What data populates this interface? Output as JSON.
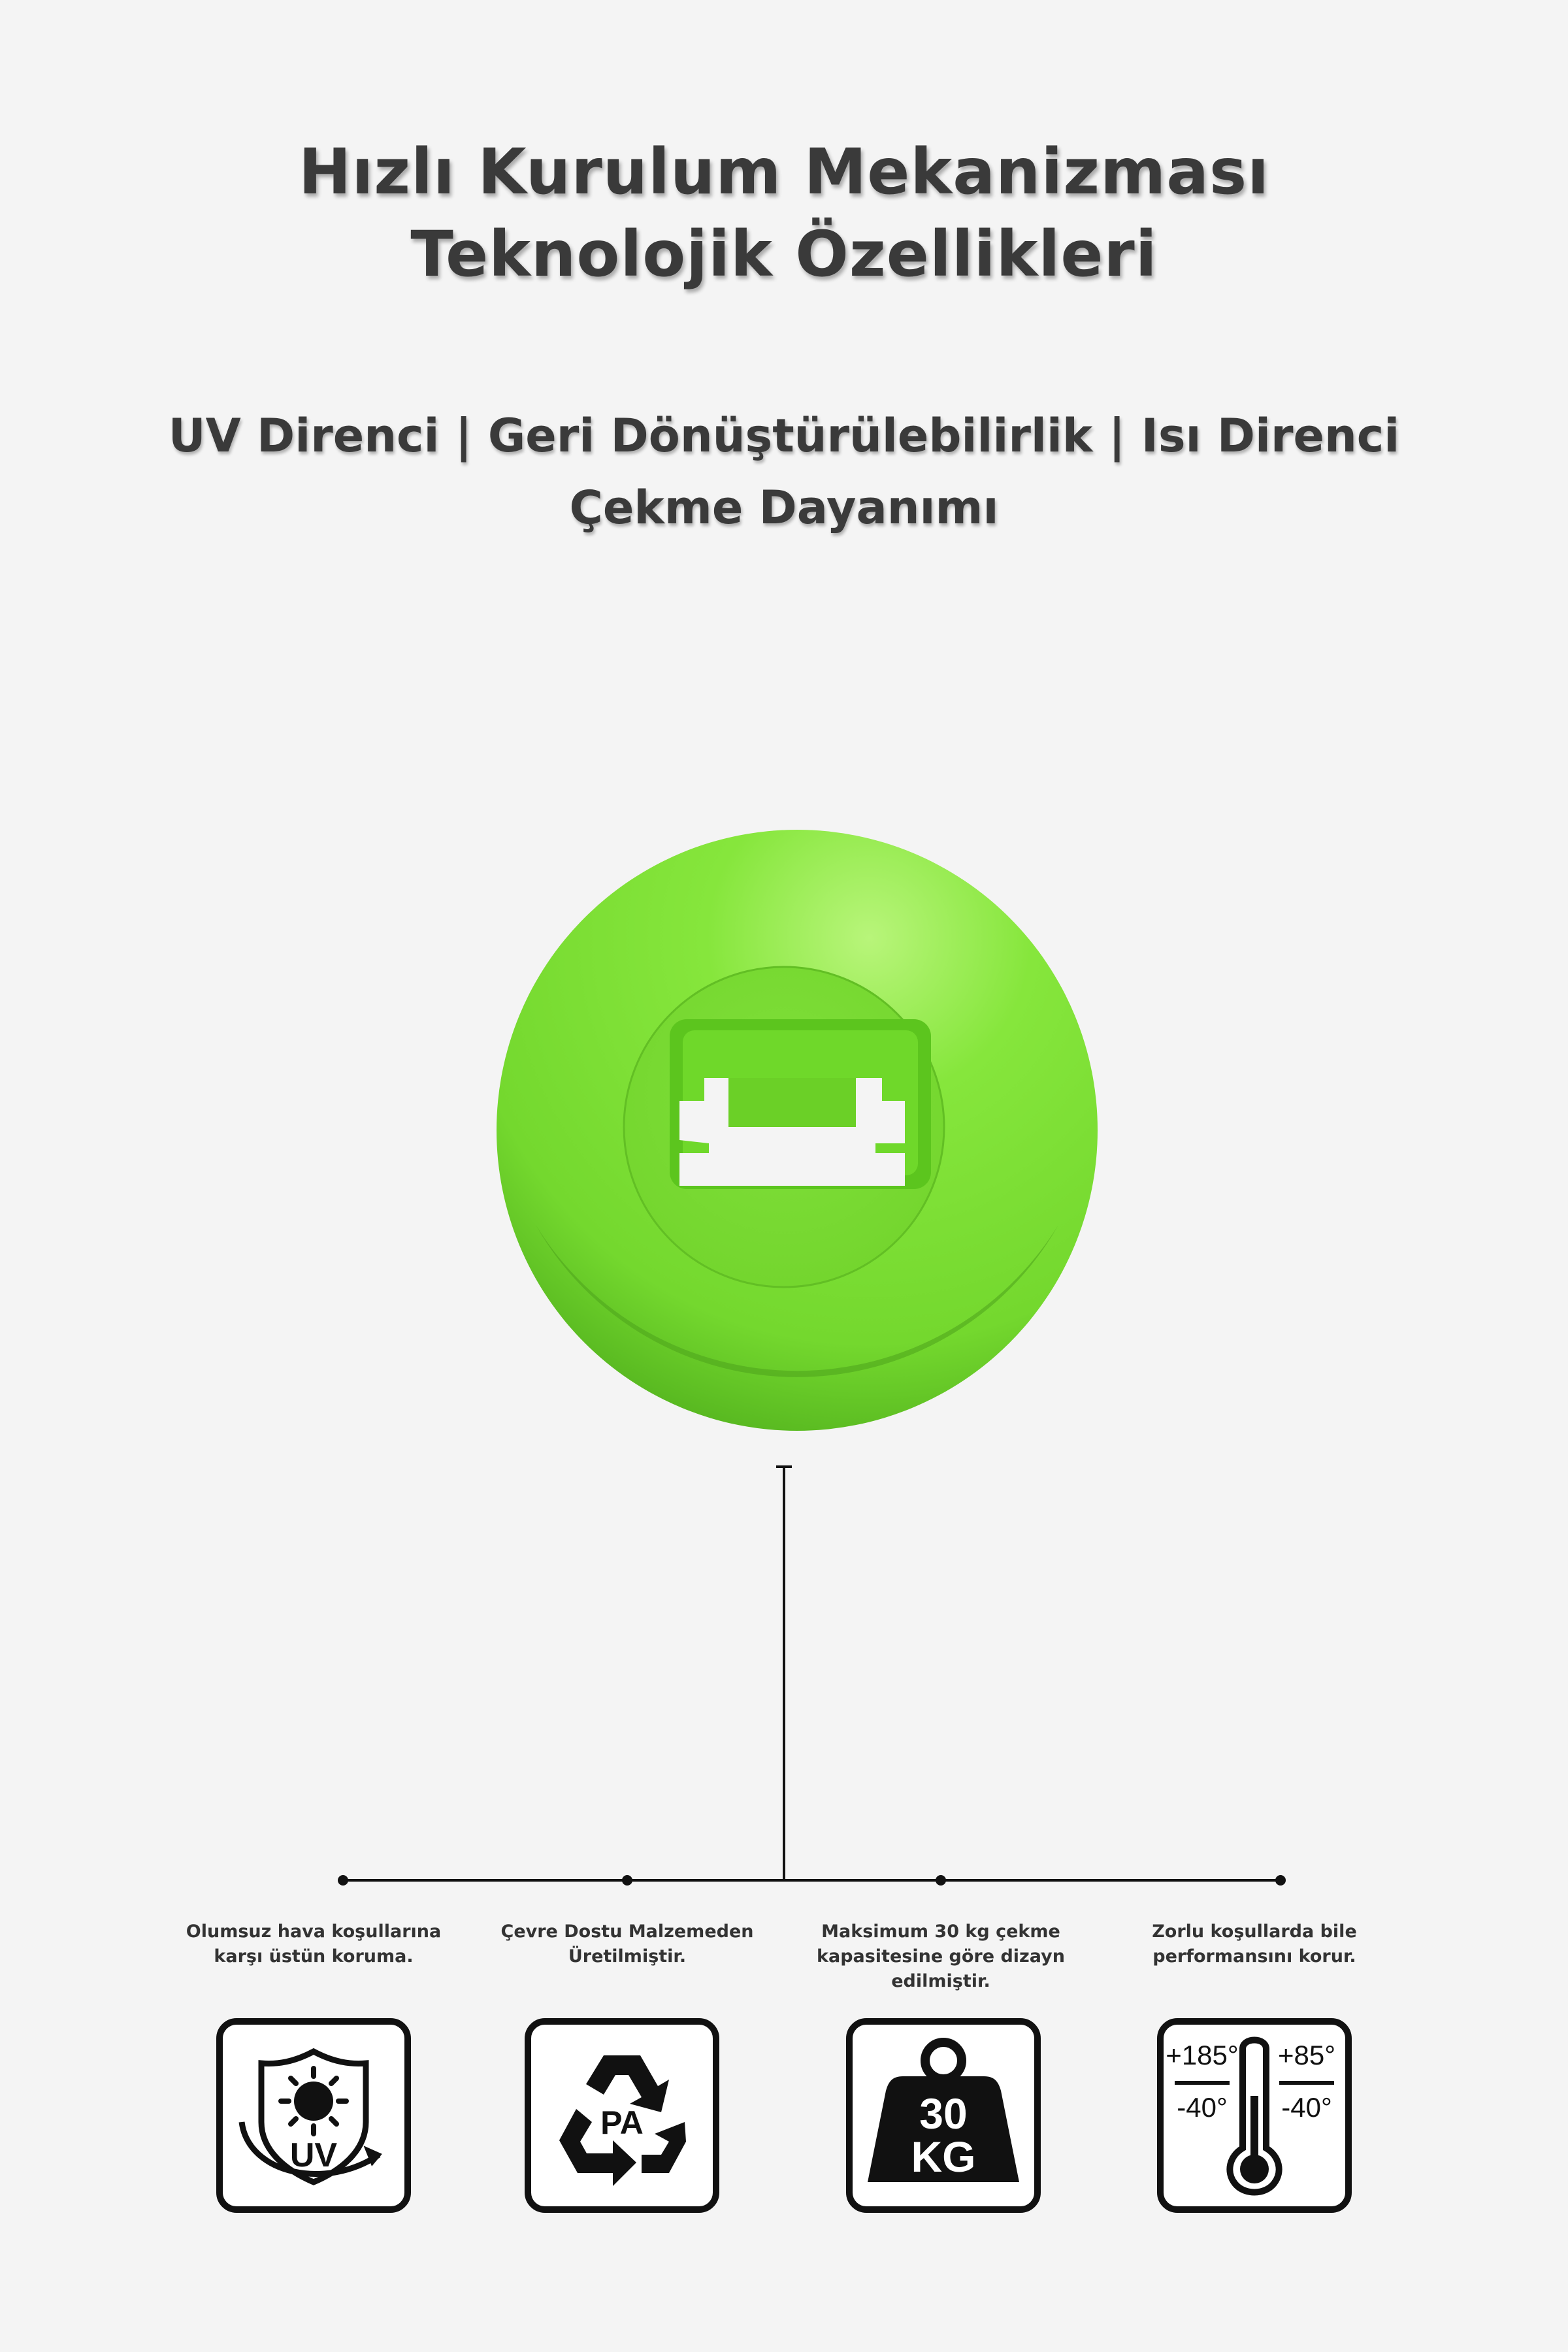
{
  "title": {
    "line1": "Hızlı Kurulum Mekanizması",
    "line2": "Teknolojik Özellikleri"
  },
  "subtitle": {
    "line1": "UV Direnci | Geri Dönüştürülebilirlik | Isı Direnci",
    "line2": "Çekme Dayanımı"
  },
  "colors": {
    "background": "#f4f4f4",
    "product_green": "#7ddf35",
    "text": "#3a3a3a",
    "icon_stroke": "#111111"
  },
  "features": [
    {
      "caption_line1": "Olumsuz hava koşullarına",
      "caption_line2": "karşı üstün koruma.",
      "caption_line3": "",
      "icon": "uv-shield-icon",
      "icon_text": "UV"
    },
    {
      "caption_line1": "Çevre Dostu Malzemeden",
      "caption_line2": "Üretilmiştir.",
      "caption_line3": "",
      "icon": "recycle-icon",
      "icon_text": "PA"
    },
    {
      "caption_line1": "Maksimum 30 kg çekme",
      "caption_line2": "kapasitesine göre dizayn",
      "caption_line3": "edilmiştir.",
      "icon": "weight-icon",
      "icon_text_1": "30",
      "icon_text_2": "KG"
    },
    {
      "caption_line1": "Zorlu koşullarda bile",
      "caption_line2": "performansını korur.",
      "caption_line3": "",
      "icon": "thermometer-icon",
      "temp_high_1": "+185°",
      "temp_low_1": "-40°",
      "temp_high_2": "+85°",
      "temp_low_2": "-40°"
    }
  ]
}
